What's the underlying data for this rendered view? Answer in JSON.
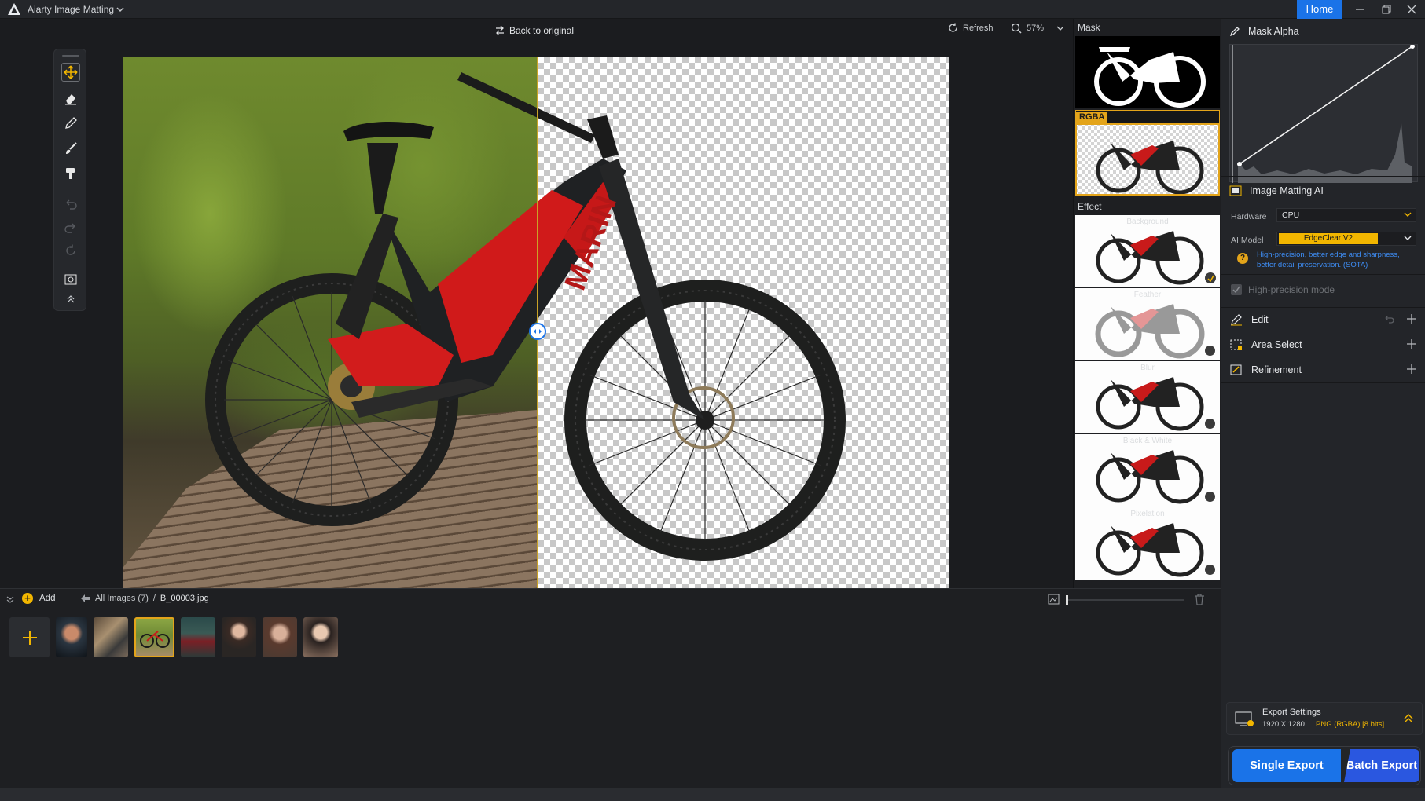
{
  "app": {
    "title": "Aiarty Image Matting",
    "home_label": "Home"
  },
  "canvas": {
    "back_to_original": "Back to original",
    "refresh_label": "Refresh",
    "zoom_level": "57%"
  },
  "tools": [
    {
      "name": "move-tool-icon"
    },
    {
      "name": "eraser-tool-icon"
    },
    {
      "name": "pen-tool-icon"
    },
    {
      "name": "brush-tool-icon"
    },
    {
      "name": "fill-tool-icon"
    },
    {
      "name": "undo-icon"
    },
    {
      "name": "redo-icon"
    },
    {
      "name": "reset-icon"
    },
    {
      "name": "view-mode-icon"
    },
    {
      "name": "collapse-up-icon"
    }
  ],
  "preview": {
    "mask_label": "Mask",
    "rgba_label": "RGBA",
    "effect_label": "Effect",
    "effects": [
      "Background",
      "Feather",
      "Blur",
      "Black & White",
      "Pixelation"
    ]
  },
  "panel": {
    "mask_alpha_title": "Mask Alpha",
    "matting_title": "Image Matting AI",
    "hardware_label": "Hardware",
    "hardware_value": "CPU",
    "ai_model_label": "AI Model",
    "ai_model_value": "EdgeClear  V2",
    "ai_model_hint": "High-precision, better edge and sharpness, better detail preservation. (SOTA)",
    "high_precision_label": "High-precision mode",
    "edit_label": "Edit",
    "area_select_label": "Area Select",
    "refinement_label": "Refinement",
    "export_settings_title": "Export Settings",
    "export_resolution": "1920 X 1280",
    "export_format": "PNG (RGBA) [8 bits]",
    "single_export": "Single Export",
    "batch_export": "Batch Export"
  },
  "files": {
    "add_label": "Add",
    "all_images": "All Images (7)",
    "separator": "/",
    "current_file": "B_00003.jpg",
    "thumbnails": [
      "jellyfish",
      "bird",
      "bicycle",
      "woman-red-dress",
      "woman-flowers",
      "woman-portrait",
      "woman-floral"
    ],
    "selected_index": 2
  },
  "colors": {
    "accent_blue": "#1a73e8",
    "accent_yellow": "#f2b600",
    "selection_orange": "#e3a41a",
    "split_line": "#c9a227"
  }
}
